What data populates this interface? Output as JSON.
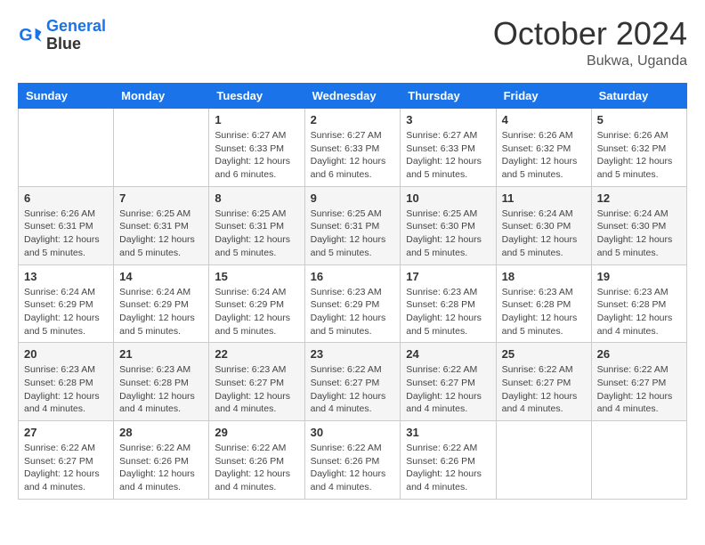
{
  "header": {
    "logo_line1": "General",
    "logo_line2": "Blue",
    "month": "October 2024",
    "location": "Bukwa, Uganda"
  },
  "weekdays": [
    "Sunday",
    "Monday",
    "Tuesday",
    "Wednesday",
    "Thursday",
    "Friday",
    "Saturday"
  ],
  "weeks": [
    [
      null,
      null,
      {
        "day": "1",
        "sunrise": "6:27 AM",
        "sunset": "6:33 PM",
        "daylight": "12 hours and 6 minutes."
      },
      {
        "day": "2",
        "sunrise": "6:27 AM",
        "sunset": "6:33 PM",
        "daylight": "12 hours and 6 minutes."
      },
      {
        "day": "3",
        "sunrise": "6:27 AM",
        "sunset": "6:33 PM",
        "daylight": "12 hours and 5 minutes."
      },
      {
        "day": "4",
        "sunrise": "6:26 AM",
        "sunset": "6:32 PM",
        "daylight": "12 hours and 5 minutes."
      },
      {
        "day": "5",
        "sunrise": "6:26 AM",
        "sunset": "6:32 PM",
        "daylight": "12 hours and 5 minutes."
      }
    ],
    [
      {
        "day": "6",
        "sunrise": "6:26 AM",
        "sunset": "6:31 PM",
        "daylight": "12 hours and 5 minutes."
      },
      {
        "day": "7",
        "sunrise": "6:25 AM",
        "sunset": "6:31 PM",
        "daylight": "12 hours and 5 minutes."
      },
      {
        "day": "8",
        "sunrise": "6:25 AM",
        "sunset": "6:31 PM",
        "daylight": "12 hours and 5 minutes."
      },
      {
        "day": "9",
        "sunrise": "6:25 AM",
        "sunset": "6:31 PM",
        "daylight": "12 hours and 5 minutes."
      },
      {
        "day": "10",
        "sunrise": "6:25 AM",
        "sunset": "6:30 PM",
        "daylight": "12 hours and 5 minutes."
      },
      {
        "day": "11",
        "sunrise": "6:24 AM",
        "sunset": "6:30 PM",
        "daylight": "12 hours and 5 minutes."
      },
      {
        "day": "12",
        "sunrise": "6:24 AM",
        "sunset": "6:30 PM",
        "daylight": "12 hours and 5 minutes."
      }
    ],
    [
      {
        "day": "13",
        "sunrise": "6:24 AM",
        "sunset": "6:29 PM",
        "daylight": "12 hours and 5 minutes."
      },
      {
        "day": "14",
        "sunrise": "6:24 AM",
        "sunset": "6:29 PM",
        "daylight": "12 hours and 5 minutes."
      },
      {
        "day": "15",
        "sunrise": "6:24 AM",
        "sunset": "6:29 PM",
        "daylight": "12 hours and 5 minutes."
      },
      {
        "day": "16",
        "sunrise": "6:23 AM",
        "sunset": "6:29 PM",
        "daylight": "12 hours and 5 minutes."
      },
      {
        "day": "17",
        "sunrise": "6:23 AM",
        "sunset": "6:28 PM",
        "daylight": "12 hours and 5 minutes."
      },
      {
        "day": "18",
        "sunrise": "6:23 AM",
        "sunset": "6:28 PM",
        "daylight": "12 hours and 5 minutes."
      },
      {
        "day": "19",
        "sunrise": "6:23 AM",
        "sunset": "6:28 PM",
        "daylight": "12 hours and 4 minutes."
      }
    ],
    [
      {
        "day": "20",
        "sunrise": "6:23 AM",
        "sunset": "6:28 PM",
        "daylight": "12 hours and 4 minutes."
      },
      {
        "day": "21",
        "sunrise": "6:23 AM",
        "sunset": "6:28 PM",
        "daylight": "12 hours and 4 minutes."
      },
      {
        "day": "22",
        "sunrise": "6:23 AM",
        "sunset": "6:27 PM",
        "daylight": "12 hours and 4 minutes."
      },
      {
        "day": "23",
        "sunrise": "6:22 AM",
        "sunset": "6:27 PM",
        "daylight": "12 hours and 4 minutes."
      },
      {
        "day": "24",
        "sunrise": "6:22 AM",
        "sunset": "6:27 PM",
        "daylight": "12 hours and 4 minutes."
      },
      {
        "day": "25",
        "sunrise": "6:22 AM",
        "sunset": "6:27 PM",
        "daylight": "12 hours and 4 minutes."
      },
      {
        "day": "26",
        "sunrise": "6:22 AM",
        "sunset": "6:27 PM",
        "daylight": "12 hours and 4 minutes."
      }
    ],
    [
      {
        "day": "27",
        "sunrise": "6:22 AM",
        "sunset": "6:27 PM",
        "daylight": "12 hours and 4 minutes."
      },
      {
        "day": "28",
        "sunrise": "6:22 AM",
        "sunset": "6:26 PM",
        "daylight": "12 hours and 4 minutes."
      },
      {
        "day": "29",
        "sunrise": "6:22 AM",
        "sunset": "6:26 PM",
        "daylight": "12 hours and 4 minutes."
      },
      {
        "day": "30",
        "sunrise": "6:22 AM",
        "sunset": "6:26 PM",
        "daylight": "12 hours and 4 minutes."
      },
      {
        "day": "31",
        "sunrise": "6:22 AM",
        "sunset": "6:26 PM",
        "daylight": "12 hours and 4 minutes."
      },
      null,
      null
    ]
  ]
}
